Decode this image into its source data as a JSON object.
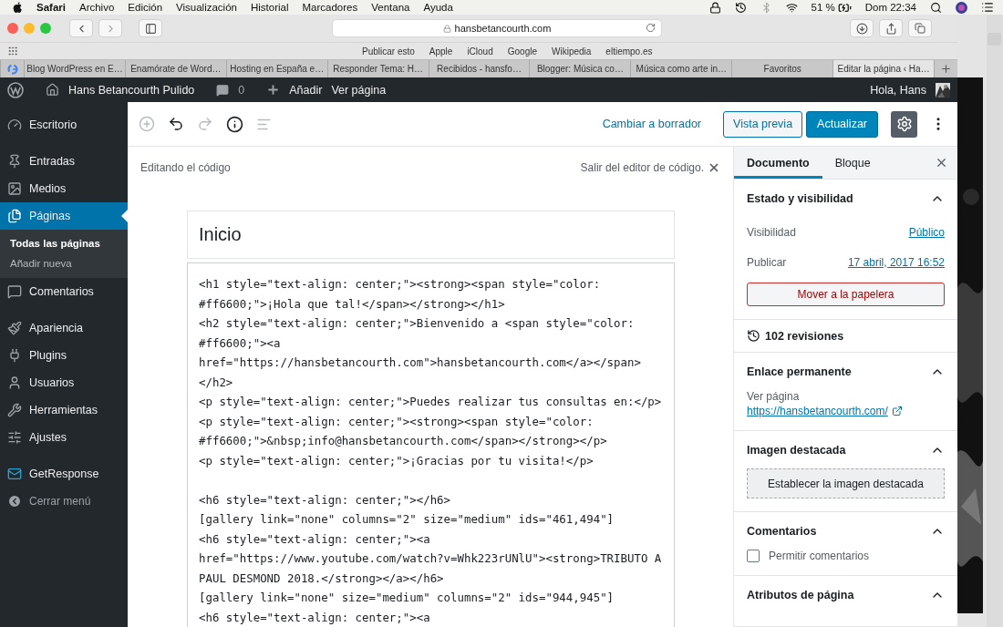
{
  "menu_bar": {
    "app": "Safari",
    "menus": [
      "Archivo",
      "Edición",
      "Visualización",
      "Historial",
      "Marcadores",
      "Ventana",
      "Ayuda"
    ],
    "battery": "51 %",
    "clock": "Dom 22:34"
  },
  "browser": {
    "url": "hansbetancourth.com",
    "bookmarks": [
      "Publicar esto",
      "Apple",
      "iCloud",
      "Google",
      "Wikipedia",
      "eltiempo.es"
    ],
    "tabs": [
      {
        "label": "Blog WordPress en E…",
        "selected": false
      },
      {
        "label": "Enamórate de Word…",
        "selected": false
      },
      {
        "label": "Hosting en España e…",
        "selected": false
      },
      {
        "label": "Responder Tema: H…",
        "selected": false
      },
      {
        "label": "Recibidos  - hansfo…",
        "selected": false
      },
      {
        "label": "Blogger: Música co…",
        "selected": false
      },
      {
        "label": "Música como arte in…",
        "selected": false
      },
      {
        "label": "Favoritos",
        "selected": false
      },
      {
        "label": "Editar la página ‹ Ha…",
        "selected": true
      }
    ]
  },
  "admin_bar": {
    "site": "Hans Betancourth Pulido",
    "comments": "0",
    "add": "Añadir",
    "view": "Ver página",
    "greeting": "Hola, Hans"
  },
  "sidebar": {
    "groups": [
      [
        {
          "label": "Escritorio",
          "selected": false
        }
      ],
      [
        {
          "label": "Entradas",
          "selected": false
        },
        {
          "label": "Medios",
          "selected": false
        },
        {
          "label": "Páginas",
          "selected": true,
          "submenu": [
            {
              "label": "Todas las páginas",
              "selected": true
            },
            {
              "label": "Añadir nueva",
              "selected": false
            }
          ]
        },
        {
          "label": "Comentarios",
          "selected": false
        }
      ],
      [
        {
          "label": "Apariencia",
          "selected": false
        },
        {
          "label": "Plugins",
          "selected": false
        },
        {
          "label": "Usuarios",
          "selected": false
        },
        {
          "label": "Herramientas",
          "selected": false
        },
        {
          "label": "Ajustes",
          "selected": false
        }
      ],
      [
        {
          "label": "GetResponse",
          "selected": false
        }
      ]
    ],
    "collapse": "Cerrar menú"
  },
  "editor": {
    "toolbar": {
      "switch_to_draft": "Cambiar a borrador",
      "preview": "Vista previa",
      "update": "Actualizar",
      "settings_open": true
    },
    "code_editor": {
      "heading": "Editando el código",
      "exit": "Salir del editor de código."
    },
    "title": "Inicio",
    "code_blocks": [
      [
        "<h1 style=\"text-align: center;\"><strong><span style=\"color:",
        "#ff6600;\">¡Hola que tal!</span></strong></h1>",
        "<h2 style=\"text-align: center;\">Bienvenido a <span style=\"color:",
        "#ff6600;\"><a",
        "href=\"https://hansbetancourth.com\">hansbetancourth.com</a></span>",
        "</h2>",
        "<p style=\"text-align: center;\">Puedes realizar tus consultas en:</p>",
        "<p style=\"text-align: center;\"><strong><span style=\"color:",
        "#ff6600;\">&nbsp;info@hansbetancourth.com</span></strong></p>",
        "<p style=\"text-align: center;\">¡Gracias por tu visita!</p>"
      ],
      [
        "<h6 style=\"text-align: center;\"></h6>",
        "[gallery link=\"none\" columns=\"2\" size=\"medium\" ids=\"461,494\"]",
        "<h6 style=\"text-align: center;\"><a",
        "href=\"https://www.youtube.com/watch?v=Whk223rUNlU\"><strong>TRIBUTO A",
        "PAUL DESMOND 2018.</strong></a></h6>",
        "[gallery link=\"none\" size=\"medium\" columns=\"2\" ids=\"944,945\"]",
        "<h6 style=\"text-align: center;\"><a"
      ]
    ]
  },
  "settings_panel": {
    "tabs": [
      {
        "label": "Documento",
        "selected": true
      },
      {
        "label": "Bloque",
        "selected": false
      }
    ],
    "sections": [
      {
        "kind": "status",
        "title": "Estado y visibilidad",
        "expanded": true,
        "rows": [
          {
            "label": "Visibilidad",
            "value": "Público"
          },
          {
            "label": "Publicar",
            "value": "17 abril, 2017 16:52"
          }
        ],
        "button": "Mover a la papelera"
      },
      {
        "kind": "revisions",
        "title": "102 revisiones"
      },
      {
        "kind": "permalink",
        "title": "Enlace permanente",
        "expanded": true,
        "label": "Ver página",
        "url": "https://hansbetancourth.com/"
      },
      {
        "kind": "featured_image",
        "title": "Imagen destacada",
        "expanded": true,
        "button": "Establecer la imagen destacada"
      },
      {
        "kind": "comments",
        "title": "Comentarios",
        "expanded": true,
        "checkbox": {
          "label": "Permitir comentarios",
          "checked": false
        }
      },
      {
        "kind": "attributes",
        "title": "Atributos de página",
        "expanded": true
      }
    ]
  }
}
